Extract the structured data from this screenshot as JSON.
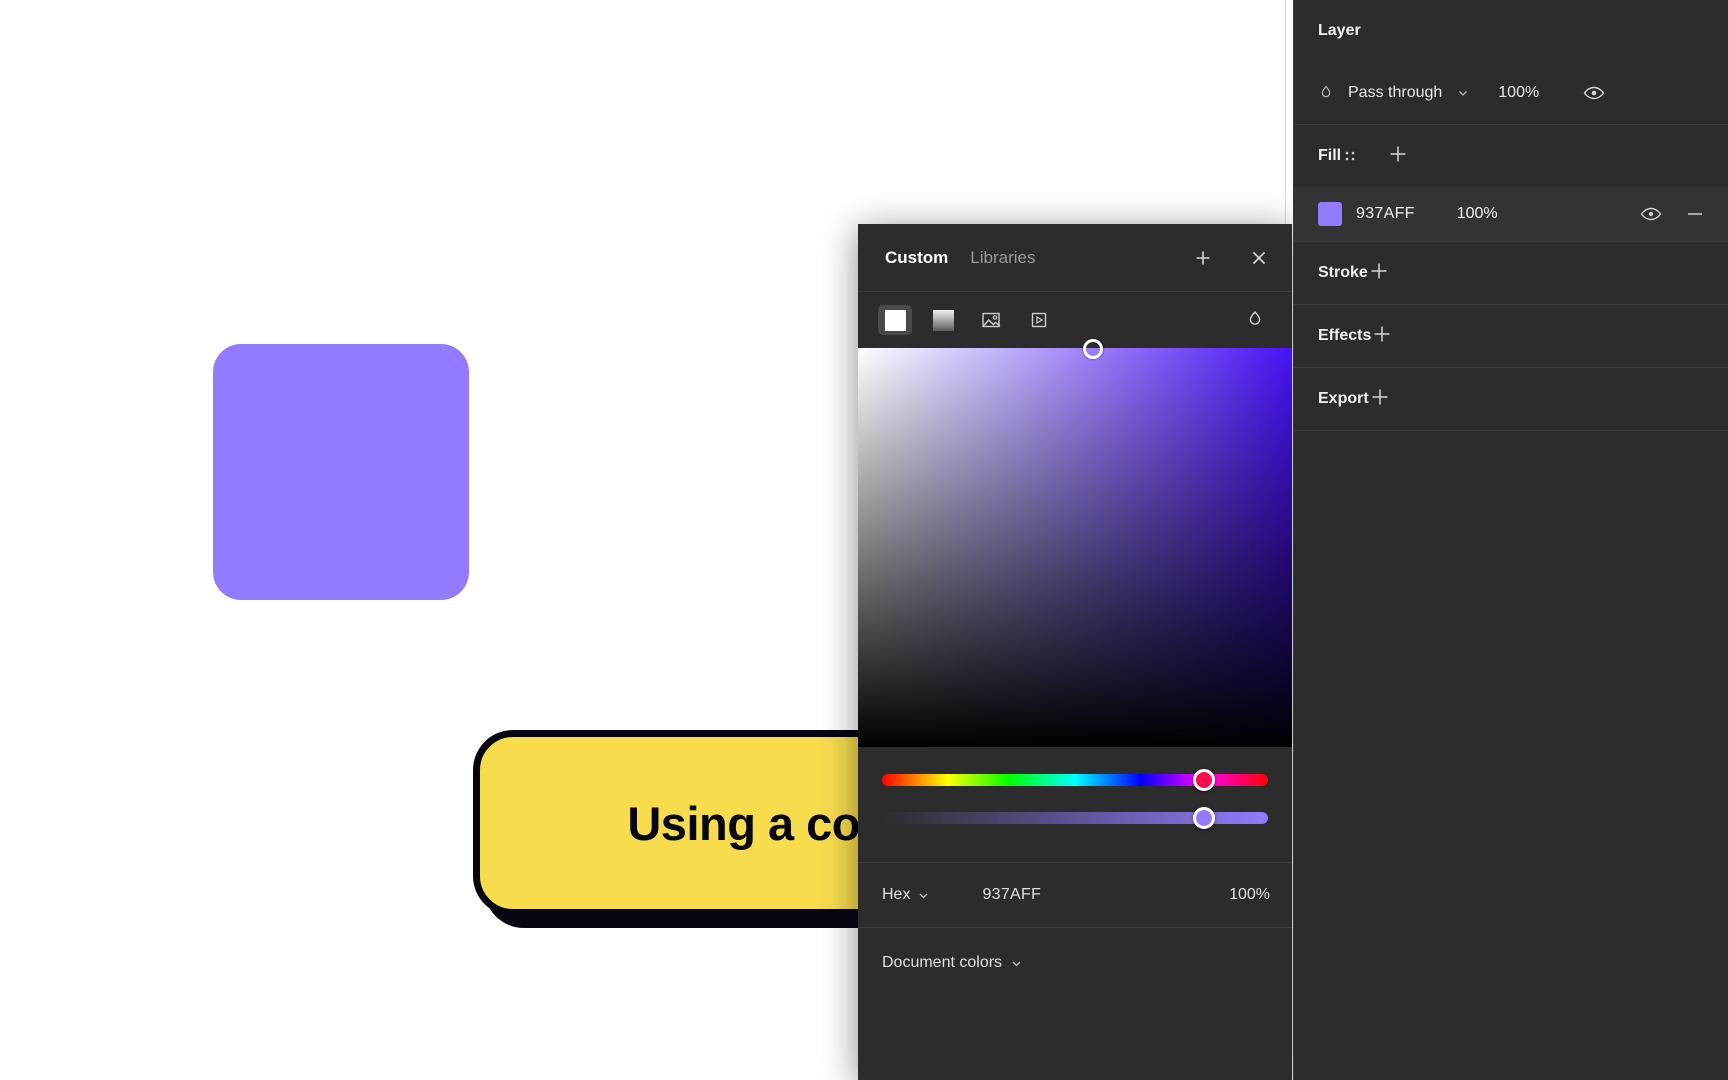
{
  "canvas": {
    "shape_color": "#937AFF",
    "background": "#FFFFFF"
  },
  "callout": {
    "text": "Using a color picker",
    "fill": "#F7DC4E",
    "border": "#05060F"
  },
  "picker": {
    "tabs": [
      {
        "label": "Custom",
        "active": true
      },
      {
        "label": "Libraries",
        "active": false
      }
    ],
    "add_label": "+",
    "close_label": "×",
    "tools": [
      {
        "name": "solid",
        "selected": true
      },
      {
        "name": "gradient",
        "selected": false
      },
      {
        "name": "image",
        "selected": false
      },
      {
        "name": "video",
        "selected": false
      }
    ],
    "eyedropper": "eyedropper",
    "hex_mode": "Hex",
    "hex_value": "937AFF",
    "opacity": "100%",
    "document_colors": "Document colors"
  },
  "properties": {
    "layer": {
      "title": "Layer",
      "blend_mode": "Pass through",
      "opacity": "100%"
    },
    "fill": {
      "title": "Fill",
      "items": [
        {
          "hex": "937AFF",
          "opacity": "100%",
          "swatch": "#937AFF"
        }
      ]
    },
    "stroke": {
      "title": "Stroke"
    },
    "effects": {
      "title": "Effects"
    },
    "export": {
      "title": "Export"
    }
  }
}
